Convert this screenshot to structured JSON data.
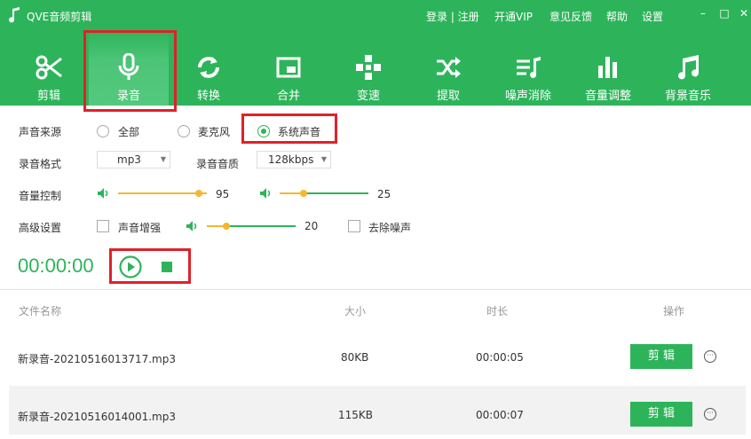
{
  "app": {
    "title": "QVE音频剪辑"
  },
  "top_links": {
    "login_register": "登录 | 注册",
    "vip": "开通VIP",
    "feedback": "意见反馈",
    "help": "帮助",
    "settings": "设置"
  },
  "window_controls": {
    "minimize": "–",
    "maximize": "□",
    "close": "✕"
  },
  "toolbar": {
    "cut": "剪辑",
    "record": "录音",
    "convert": "转换",
    "merge": "合并",
    "speed": "变速",
    "extract": "提取",
    "denoise": "噪声消除",
    "volume": "音量调整",
    "bgm": "背景音乐",
    "active": "录音"
  },
  "settings": {
    "source_label": "声音来源",
    "source_options": {
      "all": "全部",
      "mic": "麦克风",
      "system": "系统声音"
    },
    "source_selected": "系统声音",
    "format_label": "录音格式",
    "format_value": "mp3",
    "quality_label": "录音音质",
    "quality_value": "128kbps",
    "volume_label": "音量控制",
    "volume_1": "95",
    "volume_2": "25",
    "advanced_label": "高级设置",
    "enhance_label": "声音增强",
    "enhance_value": "20",
    "denoise_label": "去除噪声"
  },
  "recorder": {
    "time": "00:00:00"
  },
  "table": {
    "headers": {
      "name": "文件名称",
      "size": "大小",
      "duration": "时长",
      "action": "操作"
    },
    "rows": [
      {
        "name": "新录音-20210516013717.mp3",
        "size": "80KB",
        "duration": "00:00:05",
        "action": "剪 辑"
      },
      {
        "name": "新录音-20210516014001.mp3",
        "size": "115KB",
        "duration": "00:00:07",
        "action": "剪 辑"
      }
    ]
  },
  "colors": {
    "brand": "#2db45a",
    "highlight": "#e0202a",
    "slider": "#f5b731"
  }
}
